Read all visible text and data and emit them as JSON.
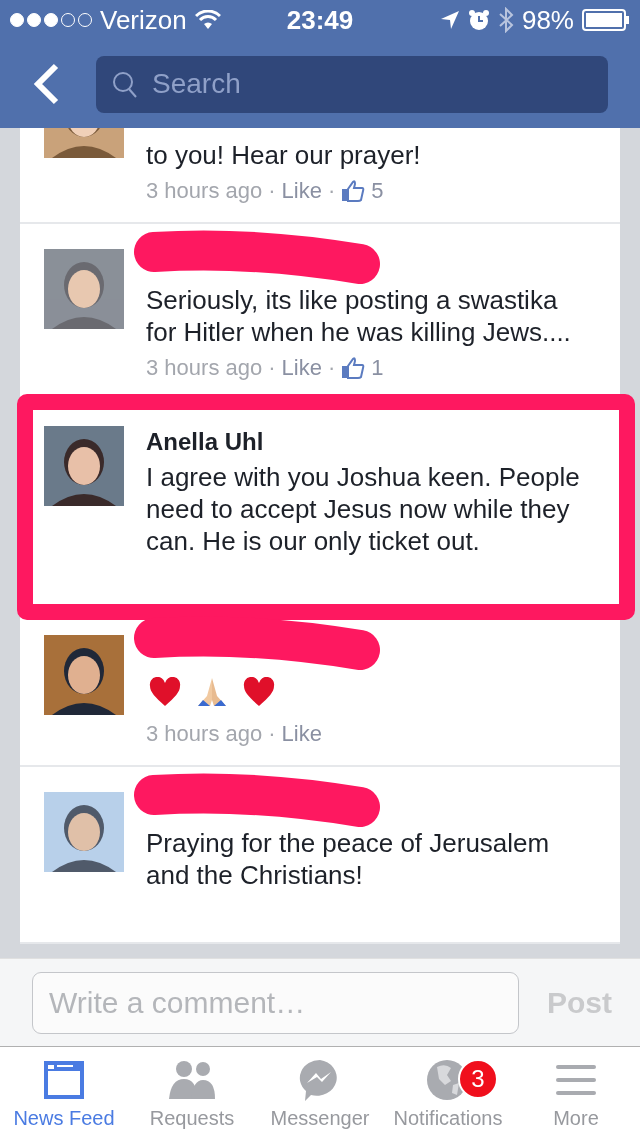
{
  "status_bar": {
    "carrier": "Verizon",
    "time": "23:49",
    "battery": "98%"
  },
  "nav": {
    "search": {
      "placeholder": "Search"
    }
  },
  "comments": [
    {
      "redacted": false,
      "body": "to you! Hear our prayer!",
      "meta": {
        "time": "3 hours ago",
        "sep": "·",
        "like": "Like",
        "likes": "5"
      }
    },
    {
      "redacted": true,
      "body": "Seriously, its like posting a swastika for Hitler when he was killing Jews....",
      "meta": {
        "time": "3 hours ago",
        "sep": "·",
        "like": "Like",
        "likes": "1"
      }
    },
    {
      "redacted": false,
      "highlighted": true,
      "name": "Anella Uhl",
      "body": "I agree with you Joshua keen. People need to accept Jesus now while they can. He is our only ticket out."
    },
    {
      "redacted": true,
      "body_icons": [
        {
          "kind": "heart"
        },
        {
          "kind": "praying-hands"
        },
        {
          "kind": "heart"
        }
      ],
      "meta": {
        "time": "3 hours ago",
        "sep": "·",
        "like": "Like"
      }
    },
    {
      "redacted": true,
      "body": "Praying for the peace of Jerusalem and the Christians!"
    }
  ],
  "composer": {
    "placeholder": "Write a comment…",
    "post": "Post"
  },
  "tabs": [
    {
      "kind": "feed",
      "label": "News Feed",
      "selected": true
    },
    {
      "kind": "requests",
      "label": "Requests",
      "selected": false
    },
    {
      "kind": "messenger",
      "label": "Messenger",
      "selected": false
    },
    {
      "kind": "notifications",
      "label": "Notifications",
      "selected": false,
      "badge": "3"
    },
    {
      "kind": "more",
      "label": "More",
      "selected": false
    }
  ]
}
